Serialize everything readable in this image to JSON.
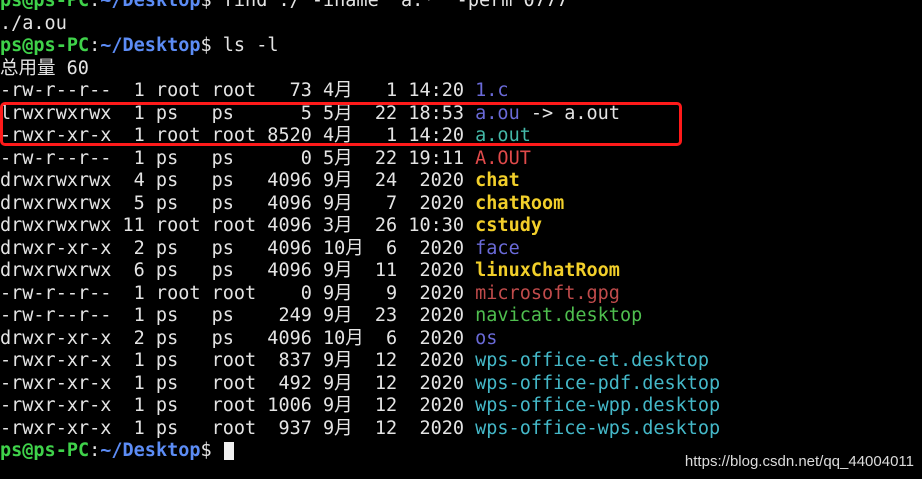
{
  "prompt": {
    "user": "ps@ps-PC",
    "sep": ":",
    "path": "~/Desktop",
    "sym": "$ "
  },
  "commands": {
    "find": "find ./ -iname 'a.*' -perm 0777",
    "find_result": "./a.ou",
    "ls": "ls -l"
  },
  "total": "总用量 60",
  "rows": [
    {
      "meta": "-rw-r--r--  1 root root   73 4月   1 14:20 ",
      "name": "1.c",
      "color": "#6a6ad8",
      "bold": false,
      "link": ""
    },
    {
      "meta": "lrwxrwxrwx  1 ps   ps      5 5月  22 18:53 ",
      "name": "a.ou",
      "color": "#6a6ad8",
      "bold": false,
      "link": " -> a.out"
    },
    {
      "meta": "-rwxr-xr-x  1 root root 8520 4月   1 14:20 ",
      "name": "a.out",
      "color": "#44b8a8",
      "bold": false,
      "link": ""
    },
    {
      "meta": "-rw-r--r--  1 ps   ps      0 5月  22 19:11 ",
      "name": "A.OUT",
      "color": "#e04a4a",
      "bold": false,
      "link": ""
    },
    {
      "meta": "drwxrwxrwx  4 ps   ps   4096 9月  24  2020 ",
      "name": "chat",
      "color": "#f2cf2a",
      "bold": true,
      "link": ""
    },
    {
      "meta": "drwxrwxrwx  5 ps   ps   4096 9月   7  2020 ",
      "name": "chatRoom",
      "color": "#f2cf2a",
      "bold": true,
      "link": ""
    },
    {
      "meta": "drwxrwxrwx 11 root root 4096 3月  26 10:30 ",
      "name": "cstudy",
      "color": "#f2cf2a",
      "bold": true,
      "link": ""
    },
    {
      "meta": "drwxr-xr-x  2 ps   ps   4096 10月  6  2020 ",
      "name": "face",
      "color": "#6a6ad8",
      "bold": false,
      "link": ""
    },
    {
      "meta": "drwxrwxrwx  6 ps   ps   4096 9月  11  2020 ",
      "name": "linuxChatRoom",
      "color": "#f2cf2a",
      "bold": true,
      "link": ""
    },
    {
      "meta": "-rw-r--r--  1 root root    0 9月   9  2020 ",
      "name": "microsoft.gpg",
      "color": "#c04b4b",
      "bold": false,
      "link": ""
    },
    {
      "meta": "-rw-r--r--  1 ps   ps    249 9月  23  2020 ",
      "name": "navicat.desktop",
      "color": "#4fbf4f",
      "bold": false,
      "link": ""
    },
    {
      "meta": "drwxr-xr-x  2 ps   ps   4096 10月  6  2020 ",
      "name": "os",
      "color": "#6a6ad8",
      "bold": false,
      "link": ""
    },
    {
      "meta": "-rwxr-xr-x  1 ps   root  837 9月  12  2020 ",
      "name": "wps-office-et.desktop",
      "color": "#44b8c8",
      "bold": false,
      "link": ""
    },
    {
      "meta": "-rwxr-xr-x  1 ps   root  492 9月  12  2020 ",
      "name": "wps-office-pdf.desktop",
      "color": "#44b8c8",
      "bold": false,
      "link": ""
    },
    {
      "meta": "-rwxr-xr-x  1 ps   root 1006 9月  12  2020 ",
      "name": "wps-office-wpp.desktop",
      "color": "#44b8c8",
      "bold": false,
      "link": ""
    },
    {
      "meta": "-rwxr-xr-x  1 ps   root  937 9月  12  2020 ",
      "name": "wps-office-wps.desktop",
      "color": "#44b8c8",
      "bold": false,
      "link": ""
    }
  ],
  "watermark": "https://blog.csdn.net/qq_44004011"
}
